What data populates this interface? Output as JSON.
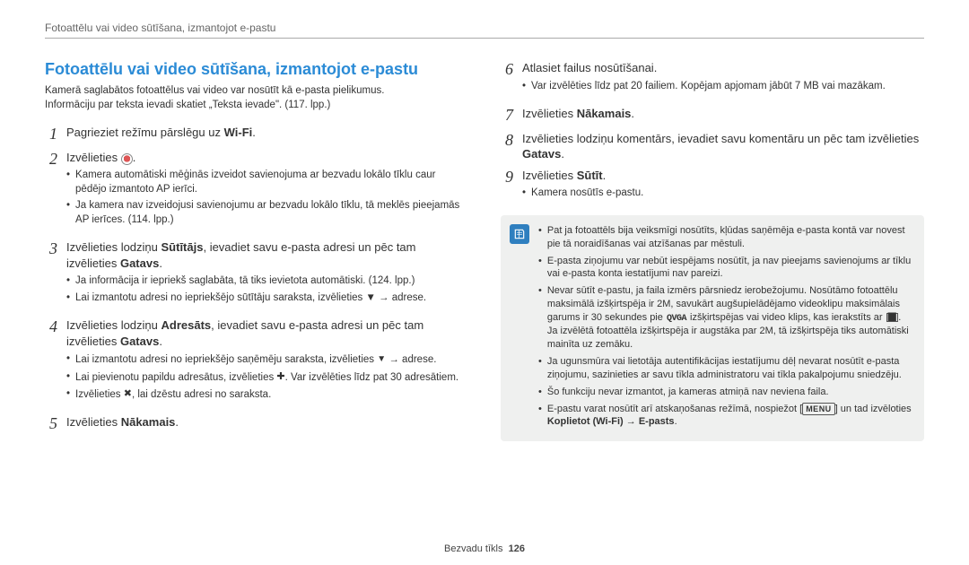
{
  "header": "Fotoattēlu vai video sūtīšana, izmantojot e-pastu",
  "title": "Fotoattēlu vai video sūtīšana, izmantojot e-pastu",
  "intro1": "Kamerā saglabātos fotoattēlus vai video var nosūtīt kā e-pasta pielikumus.",
  "intro2": "Informāciju par teksta ievadi skatiet „Teksta ievade\". (117. lpp.)",
  "wifi_label": "Wi-Fi",
  "steps_left": {
    "s1": "Pagrieziet režīmu pārslēgu uz ",
    "s2": "Izvēlieties ",
    "s2_bullets": [
      "Kamera automātiski mēģinās izveidot savienojuma ar bezvadu lokālo tīklu caur pēdējo izmantoto AP ierīci.",
      "Ja kamera nav izveidojusi savienojumu ar bezvadu lokālo tīklu, tā meklēs pieejamās AP ierīces. (114. lpp.)"
    ],
    "s3_a": "Izvēlieties lodziņu ",
    "s3_b": "Sūtītājs",
    "s3_c": ", ievadiet savu e-pasta adresi un pēc tam izvēlieties ",
    "s3_d": "Gatavs",
    "s3_bullets": [
      "Ja informācija ir iepriekš saglabāta, tā tiks ievietota automātiski. (124. lpp.)",
      "Lai izmantotu adresi no iepriekšējo sūtītāju saraksta, izvēlieties ▼ → adrese."
    ],
    "s4_a": "Izvēlieties lodziņu ",
    "s4_b": "Adresāts",
    "s4_c": ", ievadiet savu e-pasta adresi un pēc tam izvēlieties ",
    "s4_d": "Gatavs",
    "s4_bullets_a": "Lai izmantotu adresi no iepriekšējo saņēmēju saraksta, izvēlieties ",
    "s4_bullets_a2": " → adrese.",
    "s4_bullets_b": "Lai pievienotu papildu adresātus, izvēlieties ",
    "s4_bullets_b2": ". Var izvēlēties līdz pat 30 adresātiem.",
    "s4_bullets_c": "Izvēlieties ",
    "s4_bullets_c2": ", lai dzēstu adresi no saraksta.",
    "s5_a": "Izvēlieties ",
    "s5_b": "Nākamais"
  },
  "steps_right": {
    "s6": "Atlasiet failus nosūtīšanai.",
    "s6_bullets": [
      "Var izvēlēties līdz pat 20 failiem. Kopējam apjomam jābūt 7 MB vai mazākam."
    ],
    "s7_a": "Izvēlieties ",
    "s7_b": "Nākamais",
    "s8_a": "Izvēlieties lodziņu komentārs, ievadiet savu komentāru un pēc tam izvēlieties ",
    "s8_b": "Gatavs",
    "s9_a": "Izvēlieties ",
    "s9_b": "Sūtīt",
    "s9_bullets": [
      "Kamera nosūtīs e-pastu."
    ]
  },
  "notes": {
    "n1": "Pat ja fotoattēls bija veiksmīgi nosūtīts, kļūdas saņēmēja e-pasta kontā var novest pie tā noraidīšanas vai atzīšanas par mēstuli.",
    "n2": "E-pasta ziņojumu var nebūt iespējams nosūtīt, ja nav pieejams savienojums ar tīklu vai e-pasta konta iestatījumi nav pareizi.",
    "n3_a": "Nevar sūtīt e-pastu, ja faila izmērs pārsniedz ierobežojumu. Nosūtāmo fotoattēlu maksimālā izšķirtspēja ir 2M, savukārt augšupielādējamo videoklipu maksimālais garums ir 30 sekundes pie ",
    "n3_qvga": "QVGA",
    "n3_b": " izšķirtspējas vai video klips, kas ierakstīts ar ",
    "n3_c": ". Ja izvēlētā fotoattēla izšķirtspēja ir augstāka par 2M, tā izšķirtspēja tiks automātiski mainīta uz zemāku.",
    "n4": "Ja ugunsmūra vai lietotāja autentifikācijas iestatījumu dēļ nevarat nosūtīt e-pasta ziņojumu, sazinieties ar savu tīkla administratoru vai tīkla pakalpojumu sniedzēju.",
    "n5": "Šo funkciju nevar izmantot, ja kameras atmiņā nav neviena faila.",
    "n6_a": "E-pastu varat nosūtīt arī atskaņošanas režīmā, nospiežot [",
    "n6_menu": "MENU",
    "n6_b": "] un tad izvēloties ",
    "n6_c": "Koplietot (Wi-Fi)",
    "n6_d": " → ",
    "n6_e": "E-pasts"
  },
  "footer_label": "Bezvadu tīkls",
  "footer_page": "126"
}
